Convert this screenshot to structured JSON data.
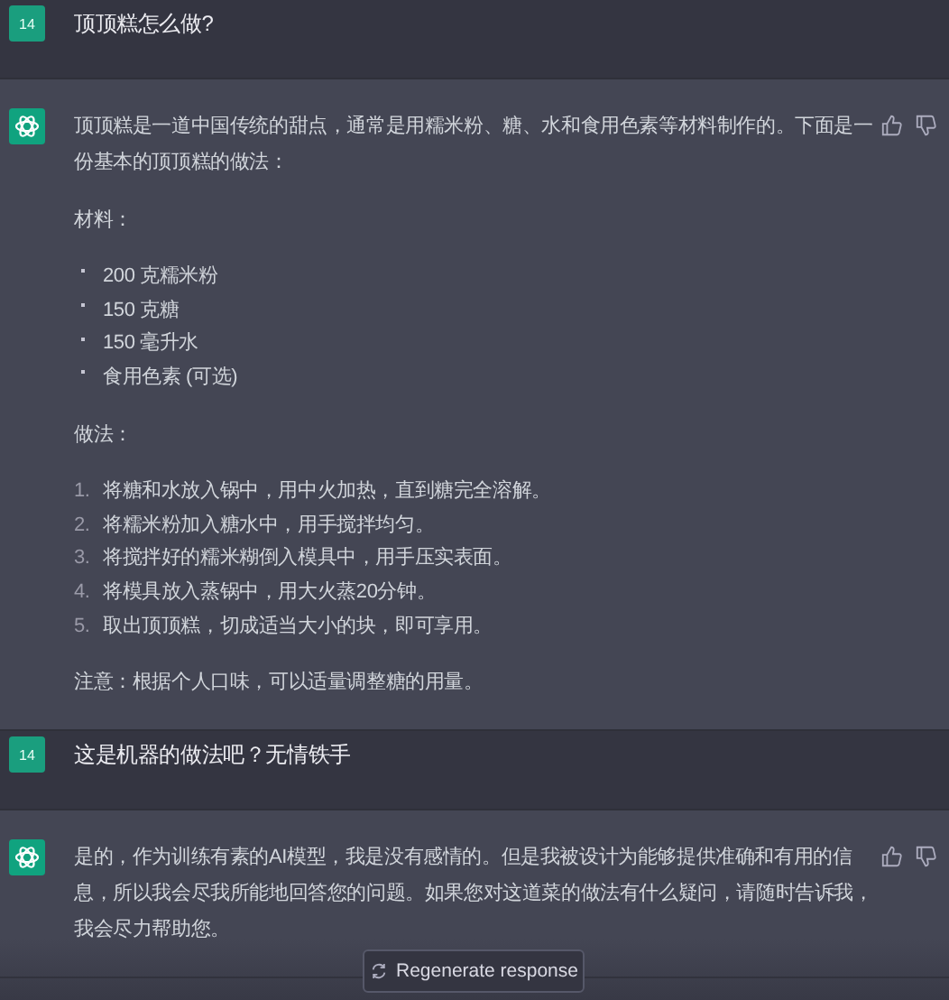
{
  "messages": [
    {
      "kind": "user",
      "avatar": "14",
      "text": "顶顶糕怎么做?"
    },
    {
      "kind": "assistant",
      "blocks": [
        {
          "kind": "paragraph",
          "text": "顶顶糕是一道中国传统的甜点，通常是用糯米粉、糖、水和食用色素等材料制作的。下面是一份基本的顶顶糕的做法："
        },
        {
          "kind": "paragraph",
          "text": "材料："
        },
        {
          "kind": "bullets",
          "items": [
            {
              "text": "200 克糯米粉"
            },
            {
              "text": "150 克糖"
            },
            {
              "text": "150 毫升水"
            },
            {
              "text": "食用色素 (可选)"
            }
          ]
        },
        {
          "kind": "paragraph",
          "text": "做法："
        },
        {
          "kind": "numbered",
          "items": [
            {
              "number": "1.",
              "text": "将糖和水放入锅中，用中火加热，直到糖完全溶解。"
            },
            {
              "number": "2.",
              "text": "将糯米粉加入糖水中，用手搅拌均匀。"
            },
            {
              "number": "3.",
              "text": "将搅拌好的糯米糊倒入模具中，用手压实表面。"
            },
            {
              "number": "4.",
              "text": "将模具放入蒸锅中，用大火蒸20分钟。"
            },
            {
              "number": "5.",
              "text": "取出顶顶糕，切成适当大小的块，即可享用。"
            }
          ]
        },
        {
          "kind": "paragraph",
          "text": "注意：根据个人口味，可以适量调整糖的用量。"
        }
      ]
    },
    {
      "kind": "user",
      "avatar": "14",
      "text": "这是机器的做法吧？无情铁手"
    },
    {
      "kind": "assistant",
      "blocks": [
        {
          "kind": "paragraph",
          "text": "是的，作为训练有素的AI模型，我是没有感情的。但是我被设计为能够提供准确和有用的信息，所以我会尽我所能地回答您的问题。如果您对这道菜的做法有什么疑问，请随时告诉我，我会尽力帮助您。"
        }
      ]
    }
  ],
  "regenerate_button": {
    "label": "Regenerate response"
  }
}
